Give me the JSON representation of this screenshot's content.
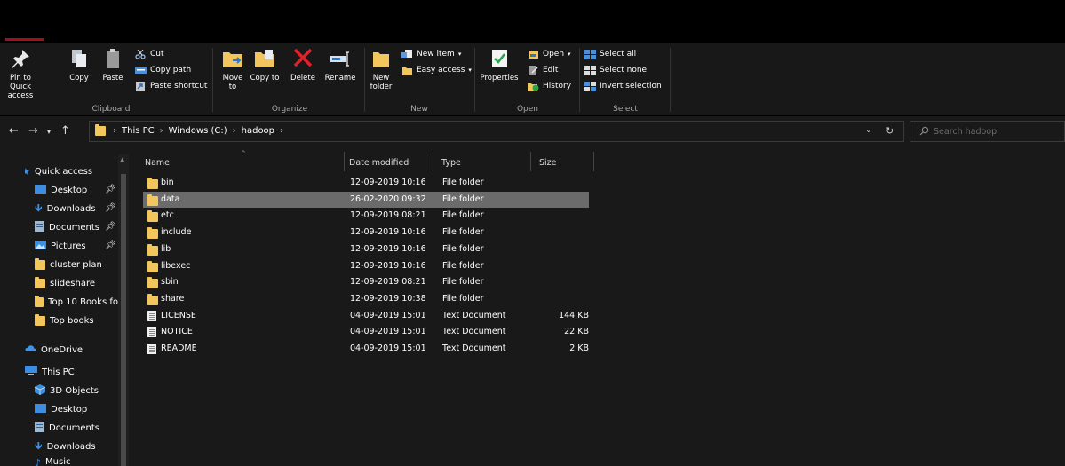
{
  "ribbon": {
    "clipboard": {
      "pin_label": "Pin to Quick access",
      "copy_label": "Copy",
      "paste_label": "Paste",
      "cut_label": "Cut",
      "copy_path_label": "Copy path",
      "paste_shortcut_label": "Paste shortcut",
      "group_label": "Clipboard"
    },
    "organize": {
      "move_to_label": "Move to",
      "copy_to_label": "Copy to",
      "delete_label": "Delete",
      "rename_label": "Rename",
      "group_label": "Organize"
    },
    "new": {
      "new_folder_label": "New folder",
      "new_item_label": "New item",
      "easy_access_label": "Easy access",
      "group_label": "New"
    },
    "open": {
      "properties_label": "Properties",
      "open_label": "Open",
      "edit_label": "Edit",
      "history_label": "History",
      "group_label": "Open"
    },
    "select": {
      "select_all_label": "Select all",
      "select_none_label": "Select none",
      "invert_selection_label": "Invert selection",
      "group_label": "Select"
    }
  },
  "address": {
    "crumbs": [
      "This PC",
      "Windows (C:)",
      "hadoop"
    ],
    "search_placeholder": "Search hadoop"
  },
  "nav": {
    "quick_access": "Quick access",
    "pinned": [
      "Desktop",
      "Downloads",
      "Documents",
      "Pictures"
    ],
    "folders": [
      "cluster plan",
      "slideshare",
      "Top 10 Books fo",
      "Top books"
    ],
    "onedrive": "OneDrive",
    "this_pc": "This PC",
    "pc_items": [
      "3D Objects",
      "Desktop",
      "Documents",
      "Downloads",
      "Music"
    ]
  },
  "columns": {
    "name": "Name",
    "date": "Date modified",
    "type": "Type",
    "size": "Size"
  },
  "files": [
    {
      "name": "bin",
      "date": "12-09-2019 10:16",
      "type": "File folder",
      "size": "",
      "icon": "folder"
    },
    {
      "name": "data",
      "date": "26-02-2020 09:32",
      "type": "File folder",
      "size": "",
      "icon": "folder"
    },
    {
      "name": "etc",
      "date": "12-09-2019 08:21",
      "type": "File folder",
      "size": "",
      "icon": "folder"
    },
    {
      "name": "include",
      "date": "12-09-2019 10:16",
      "type": "File folder",
      "size": "",
      "icon": "folder"
    },
    {
      "name": "lib",
      "date": "12-09-2019 10:16",
      "type": "File folder",
      "size": "",
      "icon": "folder"
    },
    {
      "name": "libexec",
      "date": "12-09-2019 10:16",
      "type": "File folder",
      "size": "",
      "icon": "folder"
    },
    {
      "name": "sbin",
      "date": "12-09-2019 08:21",
      "type": "File folder",
      "size": "",
      "icon": "folder"
    },
    {
      "name": "share",
      "date": "12-09-2019 10:38",
      "type": "File folder",
      "size": "",
      "icon": "folder"
    },
    {
      "name": "LICENSE",
      "date": "04-09-2019 15:01",
      "type": "Text Document",
      "size": "144 KB",
      "icon": "document"
    },
    {
      "name": "NOTICE",
      "date": "04-09-2019 15:01",
      "type": "Text Document",
      "size": "22 KB",
      "icon": "document"
    },
    {
      "name": "README",
      "date": "04-09-2019 15:01",
      "type": "Text Document",
      "size": "2 KB",
      "icon": "document"
    }
  ],
  "selected_file": "data"
}
